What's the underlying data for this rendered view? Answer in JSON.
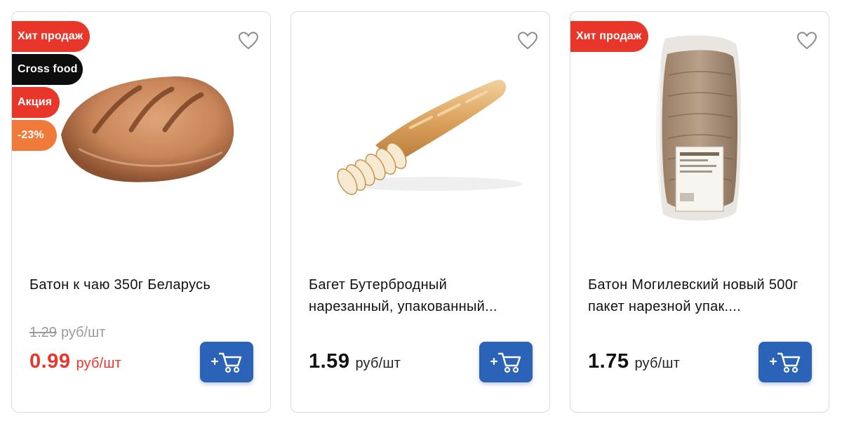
{
  "products": [
    {
      "badges": [
        "Хит продаж",
        "Cross food",
        "Акция",
        "-23%"
      ],
      "title": "Батон к чаю 350г Беларусь",
      "old_price": "1.29",
      "old_unit": "руб/шт",
      "price": "0.99",
      "unit": "руб/шт",
      "image": "loaf-image"
    },
    {
      "badges": [],
      "title": "Багет Бутербродный нарезанный, упакованный...",
      "price": "1.59",
      "unit": "руб/шт",
      "image": "sliced-baguette-image"
    },
    {
      "badges": [
        "Хит продаж"
      ],
      "title": "Батон Могилевский новый 500г пакет нарезной упак....",
      "price": "1.75",
      "unit": "руб/шт",
      "image": "packaged-loaf-image"
    }
  ],
  "icons": {
    "favorite": "heart-outline-icon",
    "cart": "add-to-cart-icon"
  },
  "colors": {
    "badge_red": "#e8372a",
    "badge_black": "#0d0d0d",
    "badge_orange": "#ef7a3a",
    "cart_button": "#2b63b8",
    "sale_price": "#e8372a"
  }
}
